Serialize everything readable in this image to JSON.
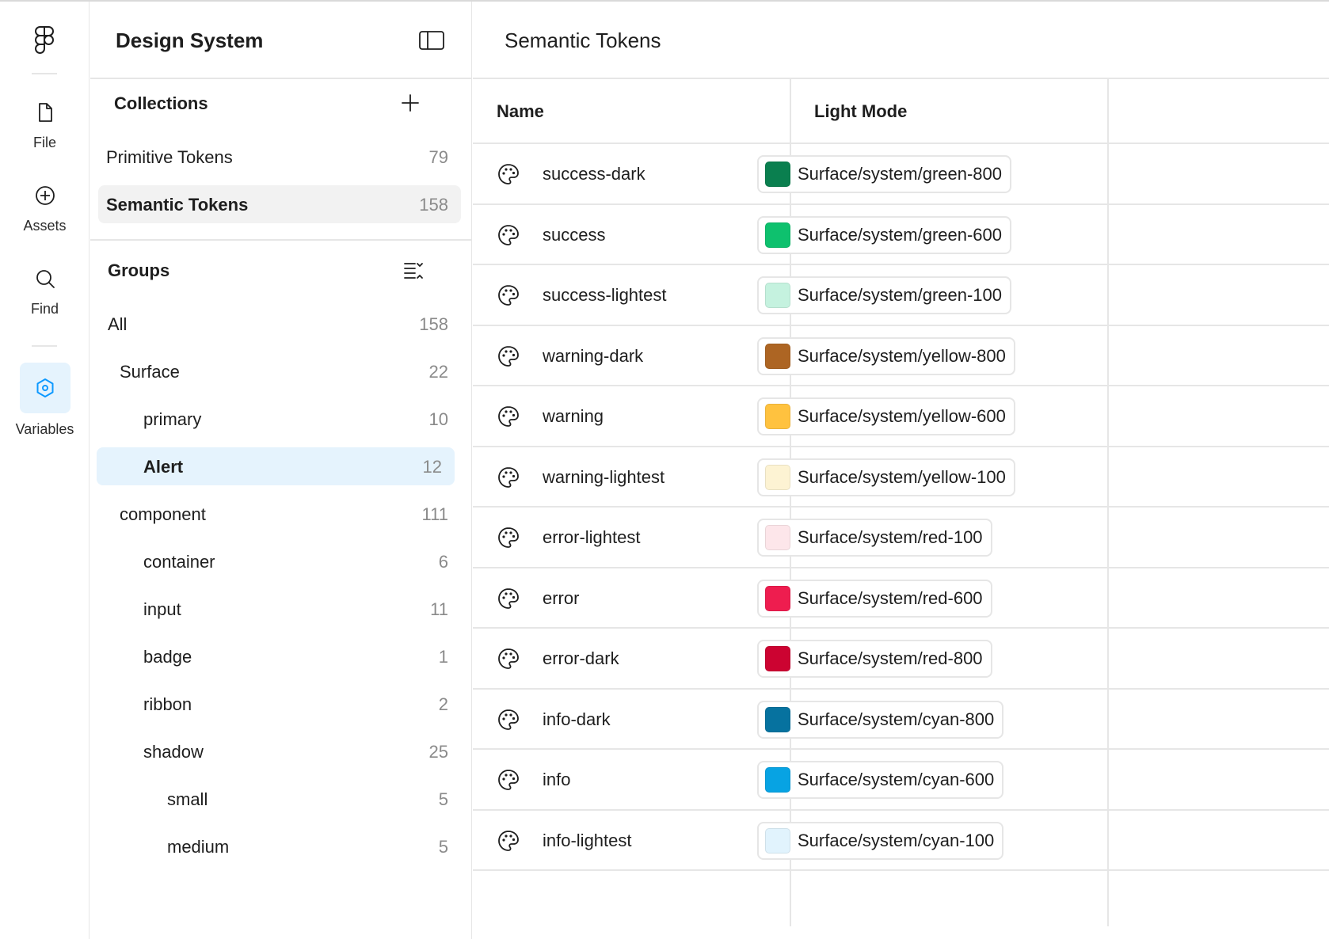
{
  "rail": {
    "items": [
      {
        "label": "File",
        "icon": "file-icon"
      },
      {
        "label": "Assets",
        "icon": "plus-circle-icon"
      },
      {
        "label": "Find",
        "icon": "search-icon"
      },
      {
        "label": "Variables",
        "icon": "variables-icon",
        "active": true
      }
    ],
    "accent_color": "#0d99ff"
  },
  "panel": {
    "title": "Design System",
    "collections": {
      "title": "Collections",
      "items": [
        {
          "label": "Primitive Tokens",
          "count": "79"
        },
        {
          "label": "Semantic Tokens",
          "count": "158",
          "selected": true
        }
      ]
    },
    "groups": {
      "title": "Groups",
      "items": [
        {
          "label": "All",
          "count": "158"
        },
        {
          "label": "Surface",
          "count": "22"
        },
        {
          "label": "primary",
          "count": "10"
        },
        {
          "label": "Alert",
          "count": "12",
          "selected": true
        },
        {
          "label": "component",
          "count": "111"
        },
        {
          "label": "container",
          "count": "6"
        },
        {
          "label": "input",
          "count": "11"
        },
        {
          "label": "badge",
          "count": "1"
        },
        {
          "label": "ribbon",
          "count": "2"
        },
        {
          "label": "shadow",
          "count": "25"
        },
        {
          "label": "small",
          "count": "5"
        },
        {
          "label": "medium",
          "count": "5"
        }
      ]
    }
  },
  "main": {
    "title": "Semantic Tokens",
    "columns": {
      "name": "Name",
      "mode": "Light Mode"
    },
    "rows": [
      {
        "name": "success-dark",
        "value": "Surface/system/green-800",
        "color": "#0a7f4f"
      },
      {
        "name": "success",
        "value": "Surface/system/green-600",
        "color": "#0ec16e"
      },
      {
        "name": "success-lightest",
        "value": "Surface/system/green-100",
        "color": "#c5f2df"
      },
      {
        "name": "warning-dark",
        "value": "Surface/system/yellow-800",
        "color": "#ad6523"
      },
      {
        "name": "warning",
        "value": "Surface/system/yellow-600",
        "color": "#ffc23f"
      },
      {
        "name": "warning-lightest",
        "value": "Surface/system/yellow-100",
        "color": "#fdf3d3"
      },
      {
        "name": "error-lightest",
        "value": "Surface/system/red-100",
        "color": "#fde6ea"
      },
      {
        "name": "error",
        "value": "Surface/system/red-600",
        "color": "#ee1d4f"
      },
      {
        "name": "error-dark",
        "value": "Surface/system/red-800",
        "color": "#cc0331"
      },
      {
        "name": "info-dark",
        "value": "Surface/system/cyan-800",
        "color": "#06729f"
      },
      {
        "name": "info",
        "value": "Surface/system/cyan-600",
        "color": "#07a3e3"
      },
      {
        "name": "info-lightest",
        "value": "Surface/system/cyan-100",
        "color": "#e1f3fd"
      }
    ]
  }
}
